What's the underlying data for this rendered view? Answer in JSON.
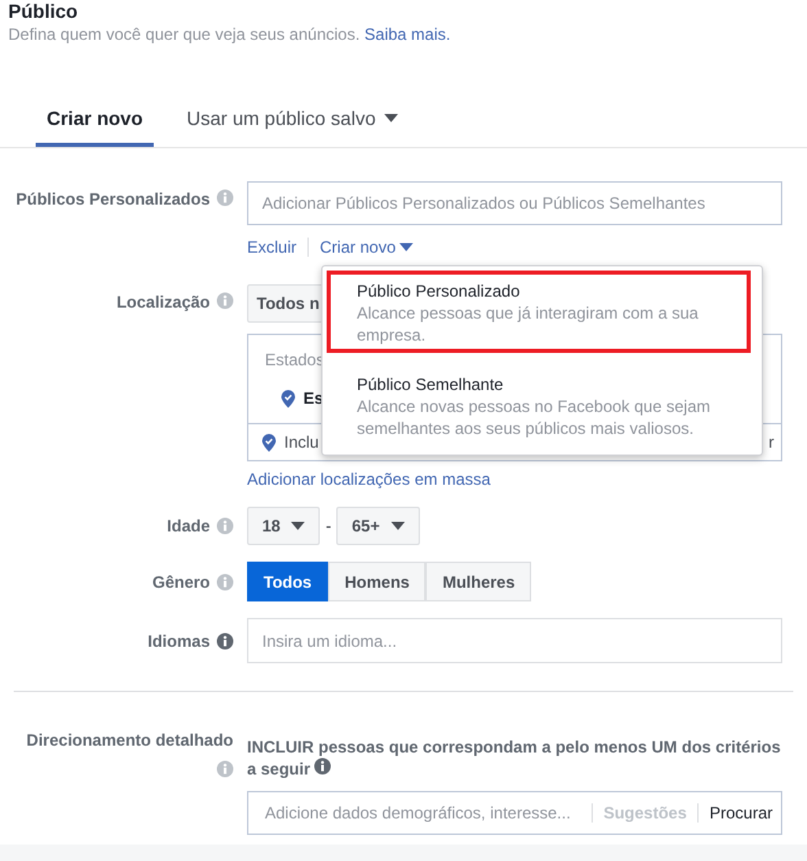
{
  "header": {
    "title": "Público",
    "subtitle": "Defina quem você quer que veja seus anúncios.",
    "link": "Saiba mais."
  },
  "tabs": [
    {
      "label": "Criar novo",
      "selected": true,
      "dropdown": false
    },
    {
      "label": "Usar um público salvo",
      "selected": false,
      "dropdown": true
    }
  ],
  "custom_audiences": {
    "label": "Públicos Personalizados",
    "placeholder": "Adicionar Públicos Personalizados ou Públicos Semelhantes",
    "links": [
      "Excluir",
      "Criar novo"
    ]
  },
  "dropdown_menu": {
    "items": [
      {
        "title": "Público Personalizado",
        "description": "Alcance pessoas que já interagiram com a sua empresa.",
        "highlighted": true
      },
      {
        "title": "Público Semelhante",
        "description": "Alcance novas pessoas no Facebook que sejam semelhantes aos seus públicos mais valiosos.",
        "highlighted": false
      }
    ]
  },
  "location": {
    "label": "Localização",
    "button": "Todos n",
    "list_header": "Estados",
    "item": "Es",
    "footer": "Inclu",
    "footer_end": "r",
    "bulk_link": "Adicionar localizações em massa"
  },
  "age": {
    "label": "Idade",
    "min": "18",
    "separator": "-",
    "max": "65+"
  },
  "gender": {
    "label": "Gênero",
    "options": [
      {
        "label": "Todos",
        "selected": true
      },
      {
        "label": "Homens",
        "selected": false
      },
      {
        "label": "Mulheres",
        "selected": false
      }
    ]
  },
  "languages": {
    "label": "Idiomas",
    "placeholder": "Insira um idioma..."
  },
  "detailed_targeting": {
    "label": "Direcionamento detalhado",
    "description": "INCLUIR pessoas que correspondam a pelo menos UM dos critérios a seguir",
    "placeholder": "Adicione dados demográficos, interesse...",
    "suggestions": "Sugestões",
    "browse": "Procurar"
  }
}
